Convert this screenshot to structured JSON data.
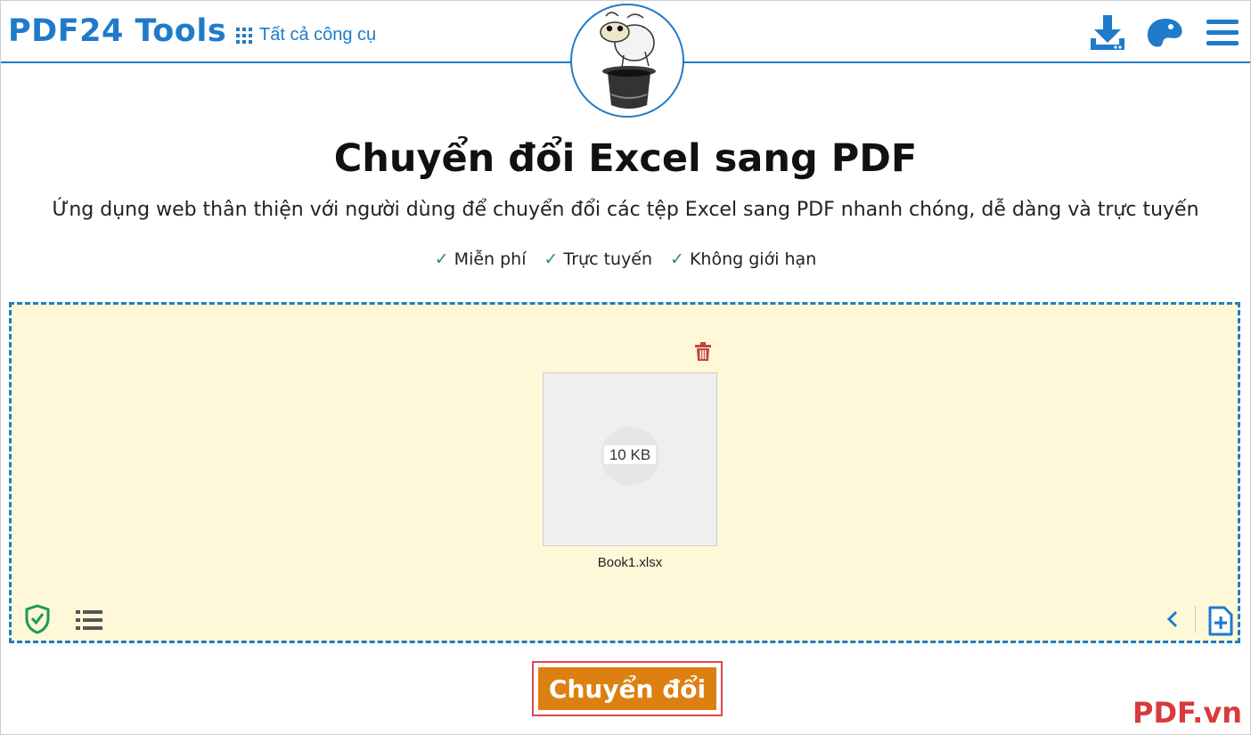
{
  "header": {
    "logo": "PDF24 Tools",
    "all_tools_label": "Tất cả công cụ",
    "icons": [
      "download-icon",
      "palette-icon",
      "menu-icon"
    ]
  },
  "main": {
    "title": "Chuyển đổi Excel sang PDF",
    "subtitle": "Ứng dụng web thân thiện với người dùng để chuyển đổi các tệp Excel sang PDF nhanh chóng, dễ dàng và trực tuyến",
    "features": [
      "Miễn phí",
      "Trực tuyến",
      "Không giới hạn"
    ],
    "check_glyph": "✓"
  },
  "dropzone": {
    "file": {
      "size": "10 KB",
      "name": "Book1.xlsx"
    },
    "icons": [
      "trash-icon",
      "shield-check-icon",
      "list-view-icon",
      "chevron-left-icon",
      "add-file-icon"
    ]
  },
  "actions": {
    "convert_label": "Chuyển đổi"
  },
  "watermark": "PDF.vn",
  "colors": {
    "brand_blue": "#1f7bc9",
    "dropzone_bg": "#fff8d8",
    "convert_orange": "#dd8012",
    "trash_red": "#c0463f",
    "shield_green": "#1e9a4f",
    "highlight_red": "#e0484b"
  }
}
